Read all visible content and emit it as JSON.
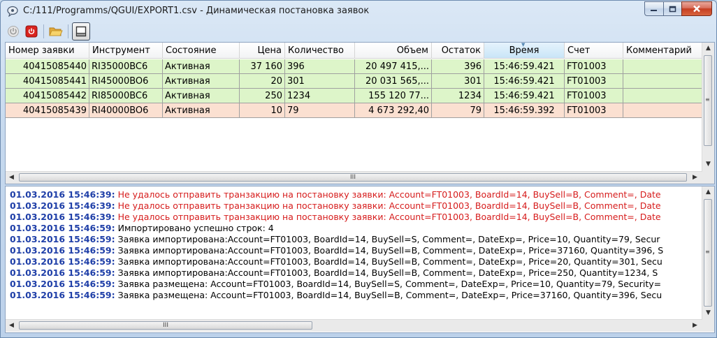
{
  "window": {
    "title": "C:/111/Programms/QGUI/EXPORT1.csv - Динамическая постановка заявок",
    "icons": {
      "app": "chat-bubble-icon",
      "minimize": "minimize-icon",
      "maximize": "maximize-icon",
      "close": "close-icon"
    }
  },
  "toolbar": {
    "buttons": [
      {
        "icon": "power-icon",
        "state": "disabled"
      },
      {
        "icon": "stop-icon",
        "color": "#d9231e"
      },
      {
        "icon": "folder-open-icon",
        "color": "#f2c24b"
      },
      {
        "icon": "window-view-icon",
        "state": "pressed"
      }
    ]
  },
  "orders_table": {
    "columns": [
      "Номер заявки",
      "Инструмент",
      "Состояние",
      "Цена",
      "Количество",
      "Объем",
      "Остаток",
      "Время",
      "Счет",
      "Комментарий"
    ],
    "sorted_column": "Время",
    "rows": [
      {
        "number": "40415085440",
        "instrument": "RI35000BC6",
        "state": "Активная",
        "price": "37 160",
        "qty": "396",
        "volume": "20 497 415,...",
        "rest": "396",
        "time": "15:46:59.421",
        "account": "FT01003",
        "comment": "",
        "color": "#ddf5c9"
      },
      {
        "number": "40415085441",
        "instrument": "RI45000BO6",
        "state": "Активная",
        "price": "20",
        "qty": "301",
        "volume": "20 031 565,...",
        "rest": "301",
        "time": "15:46:59.421",
        "account": "FT01003",
        "comment": "",
        "color": "#ddf5c9"
      },
      {
        "number": "40415085442",
        "instrument": "RI85000BC6",
        "state": "Активная",
        "price": "250",
        "qty": "1234",
        "volume": "155 120 77...",
        "rest": "1234",
        "time": "15:46:59.421",
        "account": "FT01003",
        "comment": "",
        "color": "#ddf5c9"
      },
      {
        "number": "40415085439",
        "instrument": "RI40000BO6",
        "state": "Активная",
        "price": "10",
        "qty": "79",
        "volume": "4 673 292,40",
        "rest": "79",
        "time": "15:46:59.392",
        "account": "FT01003",
        "comment": "",
        "color": "#fbe0d1"
      }
    ],
    "hscroll_grip": "III"
  },
  "log": {
    "colors": {
      "timestamp": "#1f3fa8",
      "error": "#d61c1c",
      "info": "#000000"
    },
    "lines": [
      {
        "ts": "01.03.2016 15:46:39:",
        "text": " Не удалось отправить транзакцию на постановку заявки: Account=FT01003, BoardId=14, BuySell=B, Comment=, Date",
        "type": "error"
      },
      {
        "ts": "01.03.2016 15:46:39:",
        "text": " Не удалось отправить транзакцию на постановку заявки: Account=FT01003, BoardId=14, BuySell=B, Comment=, Date",
        "type": "error"
      },
      {
        "ts": "01.03.2016 15:46:39:",
        "text": " Не удалось отправить транзакцию на постановку заявки: Account=FT01003, BoardId=14, BuySell=B, Comment=, Date",
        "type": "error"
      },
      {
        "ts": "01.03.2016 15:46:59:",
        "text": " Импортировано успешно строк: 4",
        "type": "info"
      },
      {
        "ts": "01.03.2016 15:46:59:",
        "text": " Заявка импортирована:Account=FT01003, BoardId=14, BuySell=S, Comment=, DateExp=, Price=10, Quantity=79, Secur",
        "type": "info"
      },
      {
        "ts": "01.03.2016 15:46:59:",
        "text": " Заявка импортирована:Account=FT01003, BoardId=14, BuySell=B, Comment=, DateExp=, Price=37160, Quantity=396, S",
        "type": "info"
      },
      {
        "ts": "01.03.2016 15:46:59:",
        "text": " Заявка импортирована:Account=FT01003, BoardId=14, BuySell=B, Comment=, DateExp=, Price=20, Quantity=301, Secu",
        "type": "info"
      },
      {
        "ts": "01.03.2016 15:46:59:",
        "text": " Заявка импортирована:Account=FT01003, BoardId=14, BuySell=B, Comment=, DateExp=, Price=250, Quantity=1234, S",
        "type": "info"
      },
      {
        "ts": "01.03.2016 15:46:59:",
        "text": " Заявка размещена: Account=FT01003, BoardId=14, BuySell=S, Comment=, DateExp=, Price=10, Quantity=79, Security=",
        "type": "info"
      },
      {
        "ts": "01.03.2016 15:46:59:",
        "text": " Заявка размещена: Account=FT01003, BoardId=14, BuySell=B, Comment=, DateExp=, Price=37160, Quantity=396, Secu",
        "type": "info"
      }
    ],
    "hscroll_grip": "III"
  }
}
